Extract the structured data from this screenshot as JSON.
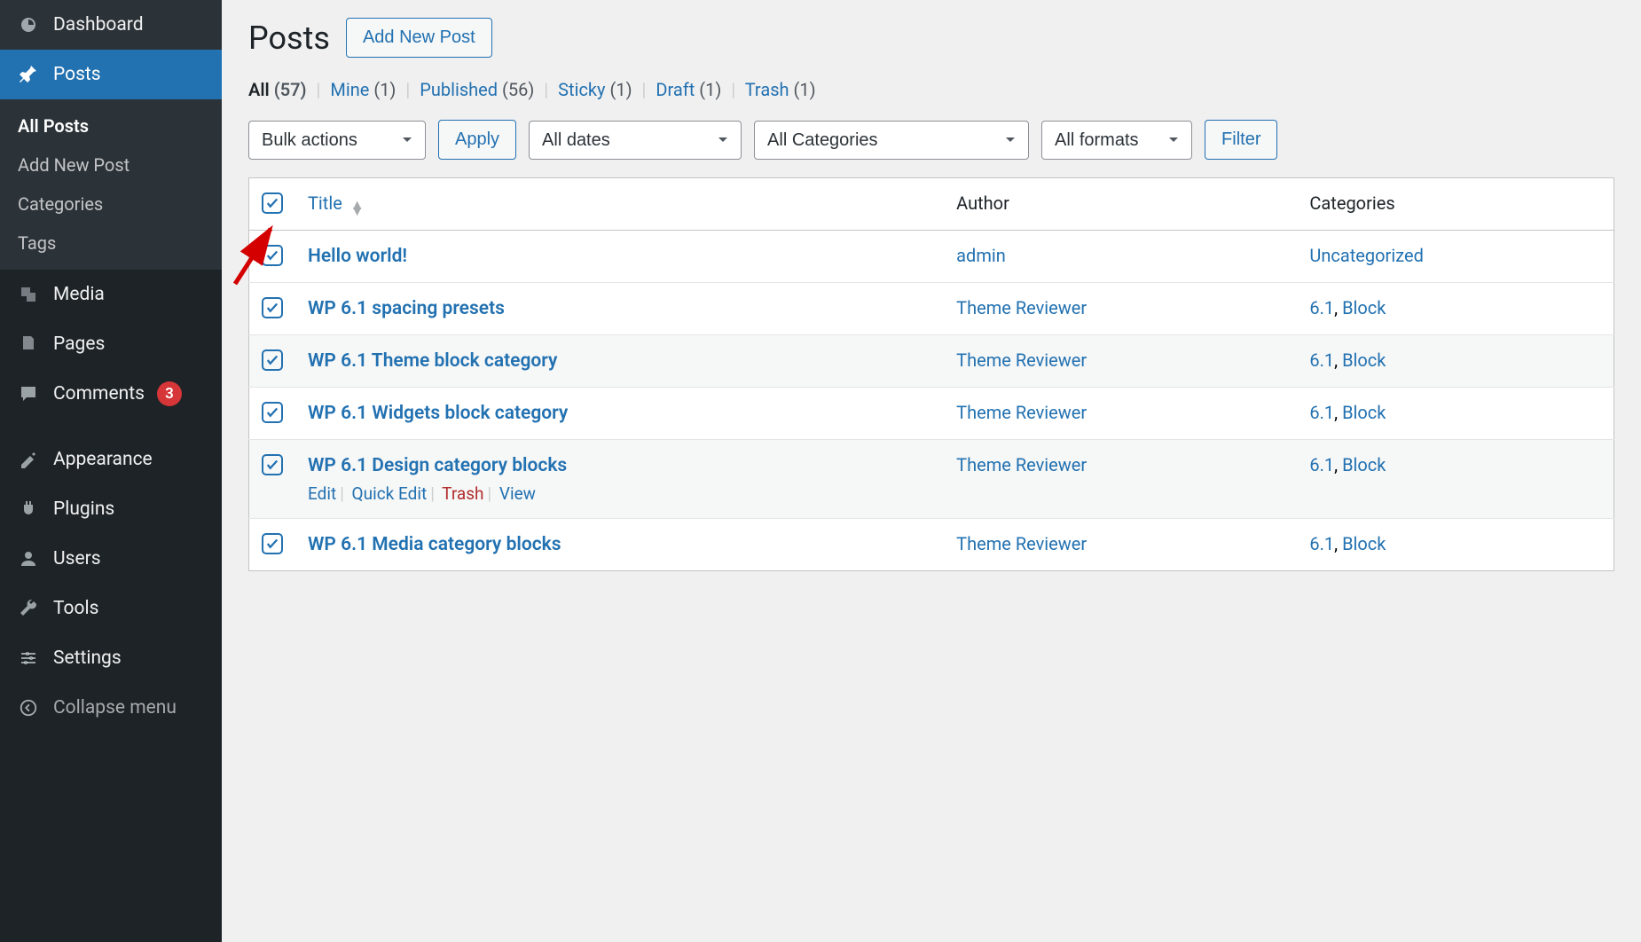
{
  "sidebar": {
    "items": [
      {
        "label": "Dashboard",
        "icon": "dashboard-icon"
      },
      {
        "label": "Posts",
        "icon": "pin-icon"
      },
      {
        "label": "Media",
        "icon": "media-icon"
      },
      {
        "label": "Pages",
        "icon": "pages-icon"
      },
      {
        "label": "Comments",
        "icon": "comments-icon",
        "badge": "3"
      },
      {
        "label": "Appearance",
        "icon": "appearance-icon"
      },
      {
        "label": "Plugins",
        "icon": "plugins-icon"
      },
      {
        "label": "Users",
        "icon": "users-icon"
      },
      {
        "label": "Tools",
        "icon": "tools-icon"
      },
      {
        "label": "Settings",
        "icon": "settings-icon"
      }
    ],
    "collapse": "Collapse menu",
    "posts_submenu": [
      {
        "label": "All Posts"
      },
      {
        "label": "Add New Post"
      },
      {
        "label": "Categories"
      },
      {
        "label": "Tags"
      }
    ]
  },
  "header": {
    "title": "Posts",
    "add_new": "Add New Post"
  },
  "filters": {
    "all_label": "All",
    "all_count": "(57)",
    "mine_label": "Mine",
    "mine_count": "(1)",
    "published_label": "Published",
    "published_count": "(56)",
    "sticky_label": "Sticky",
    "sticky_count": "(1)",
    "draft_label": "Draft",
    "draft_count": "(1)",
    "trash_label": "Trash",
    "trash_count": "(1)"
  },
  "toolbar": {
    "bulk_actions": "Bulk actions",
    "apply": "Apply",
    "all_dates": "All dates",
    "all_categories": "All Categories",
    "all_formats": "All formats",
    "filter": "Filter"
  },
  "table": {
    "columns": {
      "title": "Title",
      "author": "Author",
      "categories": "Categories"
    },
    "row_actions": {
      "edit": "Edit",
      "quick_edit": "Quick Edit",
      "trash": "Trash",
      "view": "View"
    },
    "rows": [
      {
        "title": "Hello world!",
        "author": "admin",
        "categories": "Uncategorized",
        "cat_list": [
          "Uncategorized"
        ]
      },
      {
        "title": "WP 6.1 spacing presets",
        "author": "Theme Reviewer",
        "cat_list": [
          "6.1",
          "Block"
        ]
      },
      {
        "title": "WP 6.1 Theme block category",
        "author": "Theme Reviewer",
        "cat_list": [
          "6.1",
          "Block"
        ]
      },
      {
        "title": "WP 6.1 Widgets block category",
        "author": "Theme Reviewer",
        "cat_list": [
          "6.1",
          "Block"
        ]
      },
      {
        "title": "WP 6.1 Design category blocks",
        "author": "Theme Reviewer",
        "cat_list": [
          "6.1",
          "Block"
        ],
        "show_actions": true
      },
      {
        "title": "WP 6.1 Media category blocks",
        "author": "Theme Reviewer",
        "cat_list": [
          "6.1",
          "Block"
        ]
      }
    ]
  }
}
